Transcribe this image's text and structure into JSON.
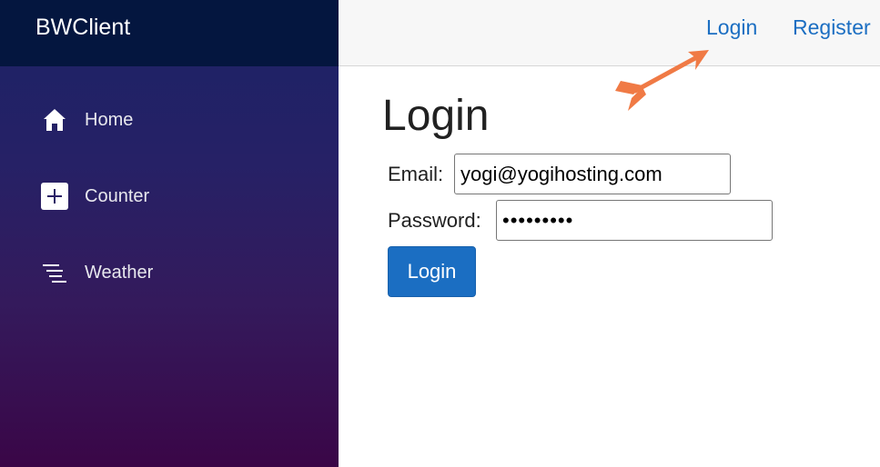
{
  "sidebar": {
    "brand": "BWClient",
    "items": [
      {
        "label": "Home",
        "icon": "home-icon"
      },
      {
        "label": "Counter",
        "icon": "plus-square-icon"
      },
      {
        "label": "Weather",
        "icon": "list-lines-icon"
      }
    ]
  },
  "topbar": {
    "login_link": "Login",
    "register_link": "Register"
  },
  "main": {
    "title": "Login",
    "email_label": "Email:",
    "email_value": "yogi@yogihosting.com",
    "password_label": "Password:",
    "password_value": "•••••••••",
    "submit_label": "Login"
  },
  "annotation": {
    "arrow_color": "#f07a45",
    "arrow_icon": "pointer-arrow-icon"
  },
  "colors": {
    "link": "#1b6ec2",
    "button": "#1b6ec2",
    "sidebar_top": "#04163f",
    "sidebar_gradient_start": "#1b2266",
    "sidebar_gradient_end": "#3a0647"
  }
}
